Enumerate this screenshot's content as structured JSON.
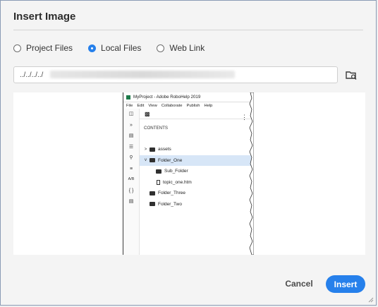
{
  "dialog": {
    "title": "Insert Image",
    "source_options": [
      {
        "label": "Project Files",
        "selected": false
      },
      {
        "label": "Local Files",
        "selected": true
      },
      {
        "label": "Web Link",
        "selected": false
      }
    ],
    "path_value": "../../../../",
    "cancel_label": "Cancel",
    "insert_label": "Insert",
    "accent_color": "#2680eb"
  },
  "preview": {
    "window_title": "MyProject - Adobe RoboHelp 2019",
    "menu": [
      "File",
      "Edit",
      "View",
      "Collaborate",
      "Publish",
      "Help"
    ],
    "contents_label": "CONTENTS",
    "rail_icons": [
      "panel-icon",
      "double-chevron-icon",
      "toc-icon",
      "list-icon",
      "key-icon",
      "bullet-list-icon",
      "ab-icon",
      "braces-icon",
      "doc-icon"
    ],
    "rail_text": [
      "»",
      "A/B",
      "{ }"
    ],
    "tree": [
      {
        "label": "assets",
        "type": "folder",
        "caret": ">",
        "indent": 0,
        "selected": false
      },
      {
        "label": "Folder_One",
        "type": "folder",
        "caret": "v",
        "indent": 0,
        "selected": true
      },
      {
        "label": "Sub_Folder",
        "type": "folder",
        "caret": "",
        "indent": 1,
        "selected": false
      },
      {
        "label": "topic_one.htm",
        "type": "file",
        "caret": "",
        "indent": 1,
        "selected": false
      },
      {
        "label": "Folder_Three",
        "type": "folder",
        "caret": "",
        "indent": 0,
        "selected": false
      },
      {
        "label": "Folder_Two",
        "type": "folder",
        "caret": "",
        "indent": 0,
        "selected": false
      }
    ]
  }
}
